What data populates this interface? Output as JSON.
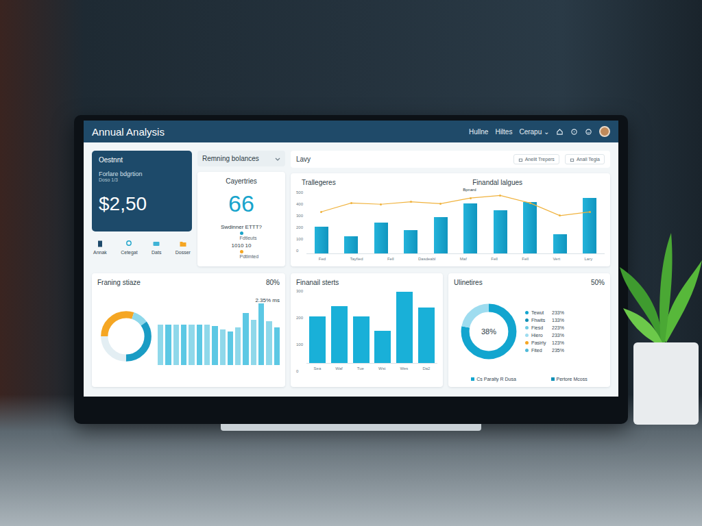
{
  "window": {
    "title": "Annual Analysis"
  },
  "header": {
    "nav": [
      {
        "label": "Hullne"
      },
      {
        "label": "Hiltes"
      },
      {
        "label": "Cerapu ⌄"
      }
    ]
  },
  "balance_card": {
    "title": "Oestnnt",
    "subtitle": "Forlare bdgrtion",
    "note": "Doso 1/3",
    "value": "$2,50"
  },
  "shortcuts": [
    {
      "label": "Annak",
      "kind": "book"
    },
    {
      "label": "Cetegat",
      "kind": "pin"
    },
    {
      "label": "Dats",
      "kind": "card"
    },
    {
      "label": "Dosser",
      "kind": "folder"
    }
  ],
  "balances_dropdown": {
    "label": "Remning bolances"
  },
  "stat_card": {
    "title": "Cayertries",
    "value": "66",
    "lines": [
      {
        "label": "Swdinner ETTT?",
        "kind": "text",
        "color": "#2b3a44"
      },
      {
        "label": "Fdtleuts",
        "kind": "dot",
        "color": "#1aa3c9"
      },
      {
        "label": "1010 10",
        "kind": "text",
        "color": "#2b3a44"
      },
      {
        "label": "Pdtlmted",
        "kind": "dot",
        "color": "#f5a623"
      }
    ]
  },
  "toolbar": {
    "title": "Lavy",
    "buttons": [
      {
        "label": "Anelit Trepers"
      },
      {
        "label": "Anall Tegia"
      }
    ]
  },
  "trend_chart": {
    "title": "Trallegeres",
    "subtitle": "Finandal lalgues",
    "y_ticks": [
      "500",
      "400",
      "300",
      "200",
      "100",
      "0"
    ],
    "x_labels": [
      "Fed",
      "Tayfied",
      "Fell",
      "Dasdeabl",
      "Maf",
      "Fell",
      "Fell",
      "Vert",
      "Lary"
    ],
    "bars": [
      210,
      135,
      245,
      185,
      290,
      395,
      340,
      410,
      150,
      440
    ],
    "line": [
      330,
      400,
      390,
      410,
      395,
      440,
      460,
      400,
      300,
      330
    ],
    "line_label": "Bpnard"
  },
  "planning": {
    "title": "Franing stiaze",
    "percent": "80%",
    "note": "2.35% ms",
    "gauge": [
      {
        "value": 30,
        "color": "#f5a623"
      },
      {
        "value": 10,
        "color": "#8fd8ea"
      },
      {
        "value": 35,
        "color": "#1a9cc4"
      },
      {
        "value": 25,
        "color": "#e3eef3"
      }
    ],
    "bars": [
      62,
      62,
      62,
      62,
      62,
      62,
      62,
      60,
      55,
      52,
      58,
      80,
      70,
      95,
      68,
      58
    ]
  },
  "finance_chart": {
    "title": "Finanail sterts",
    "y_ticks": [
      "300",
      "200",
      "100",
      "0"
    ],
    "x_labels": [
      "Sea",
      "Waf",
      "Tue",
      "Wst",
      "Wes",
      "Da2"
    ],
    "bars": [
      190,
      230,
      190,
      130,
      290,
      225
    ]
  },
  "utilities": {
    "title": "Ulinetires",
    "percent": "50%",
    "center": "38%",
    "donut": [
      {
        "value": 78,
        "color": "#12a5cf"
      },
      {
        "value": 22,
        "color": "#9edcef"
      }
    ],
    "legend": [
      {
        "label": "Tewut",
        "value": "233%",
        "color": "#12a5cf"
      },
      {
        "label": "Fhwits",
        "value": "133%",
        "color": "#0f8fb5"
      },
      {
        "label": "Fiesd",
        "value": "223%",
        "color": "#6fcbe3"
      },
      {
        "label": "Hiero",
        "value": "233%",
        "color": "#9edcef"
      },
      {
        "label": "Pasirty",
        "value": "123%",
        "color": "#f5a623"
      },
      {
        "label": "Fited",
        "value": "235%",
        "color": "#4fbad8"
      }
    ],
    "footer_legend": [
      {
        "label": "Cs Paralty R Dusa",
        "color": "#12a5cf"
      },
      {
        "label": "Pertore Mcoss",
        "color": "#0f8fb5"
      }
    ]
  }
}
